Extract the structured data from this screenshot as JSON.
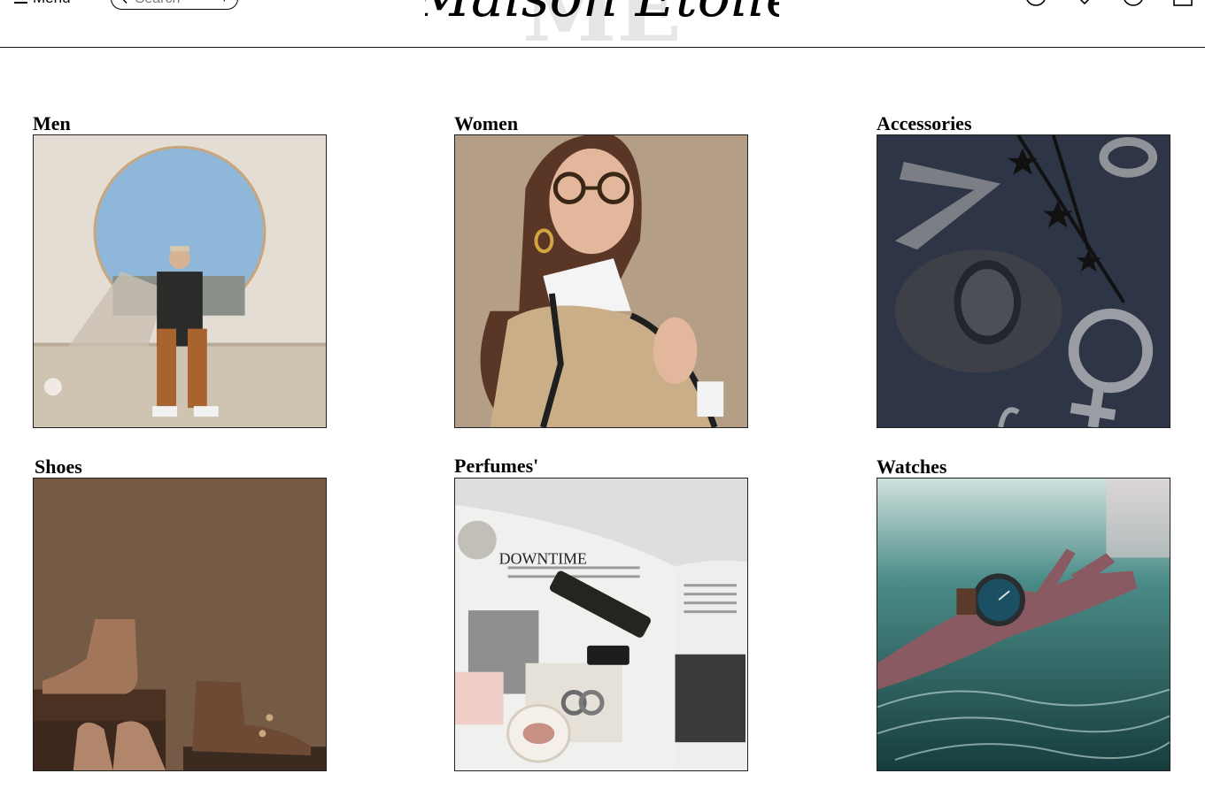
{
  "header": {
    "menu_label": "Menu",
    "search_placeholder": "Search",
    "logo": {
      "monogram": "ME",
      "script": "Maison Étoile"
    },
    "icons": [
      "help-icon",
      "wishlist-heart-icon",
      "account-icon",
      "shopping-bag-icon"
    ]
  },
  "categories": [
    {
      "label": "Men",
      "image": "man-sitting-in-circular-wall-opening"
    },
    {
      "label": "Women",
      "image": "woman-with-glasses-beige-cape"
    },
    {
      "label": "Accessories",
      "image": "metal-symbols-on-navy-background"
    },
    {
      "label": "Shoes",
      "image": "brown-leather-boots-on-vintage-cases"
    },
    {
      "label": "Perfumes'",
      "image": "perfume-bottles-on-open-magazine"
    },
    {
      "label": "Watches",
      "image": "hand-with-watch-in-water"
    }
  ],
  "colors": {
    "border": "#222222",
    "text": "#000000",
    "background": "#ffffff"
  }
}
